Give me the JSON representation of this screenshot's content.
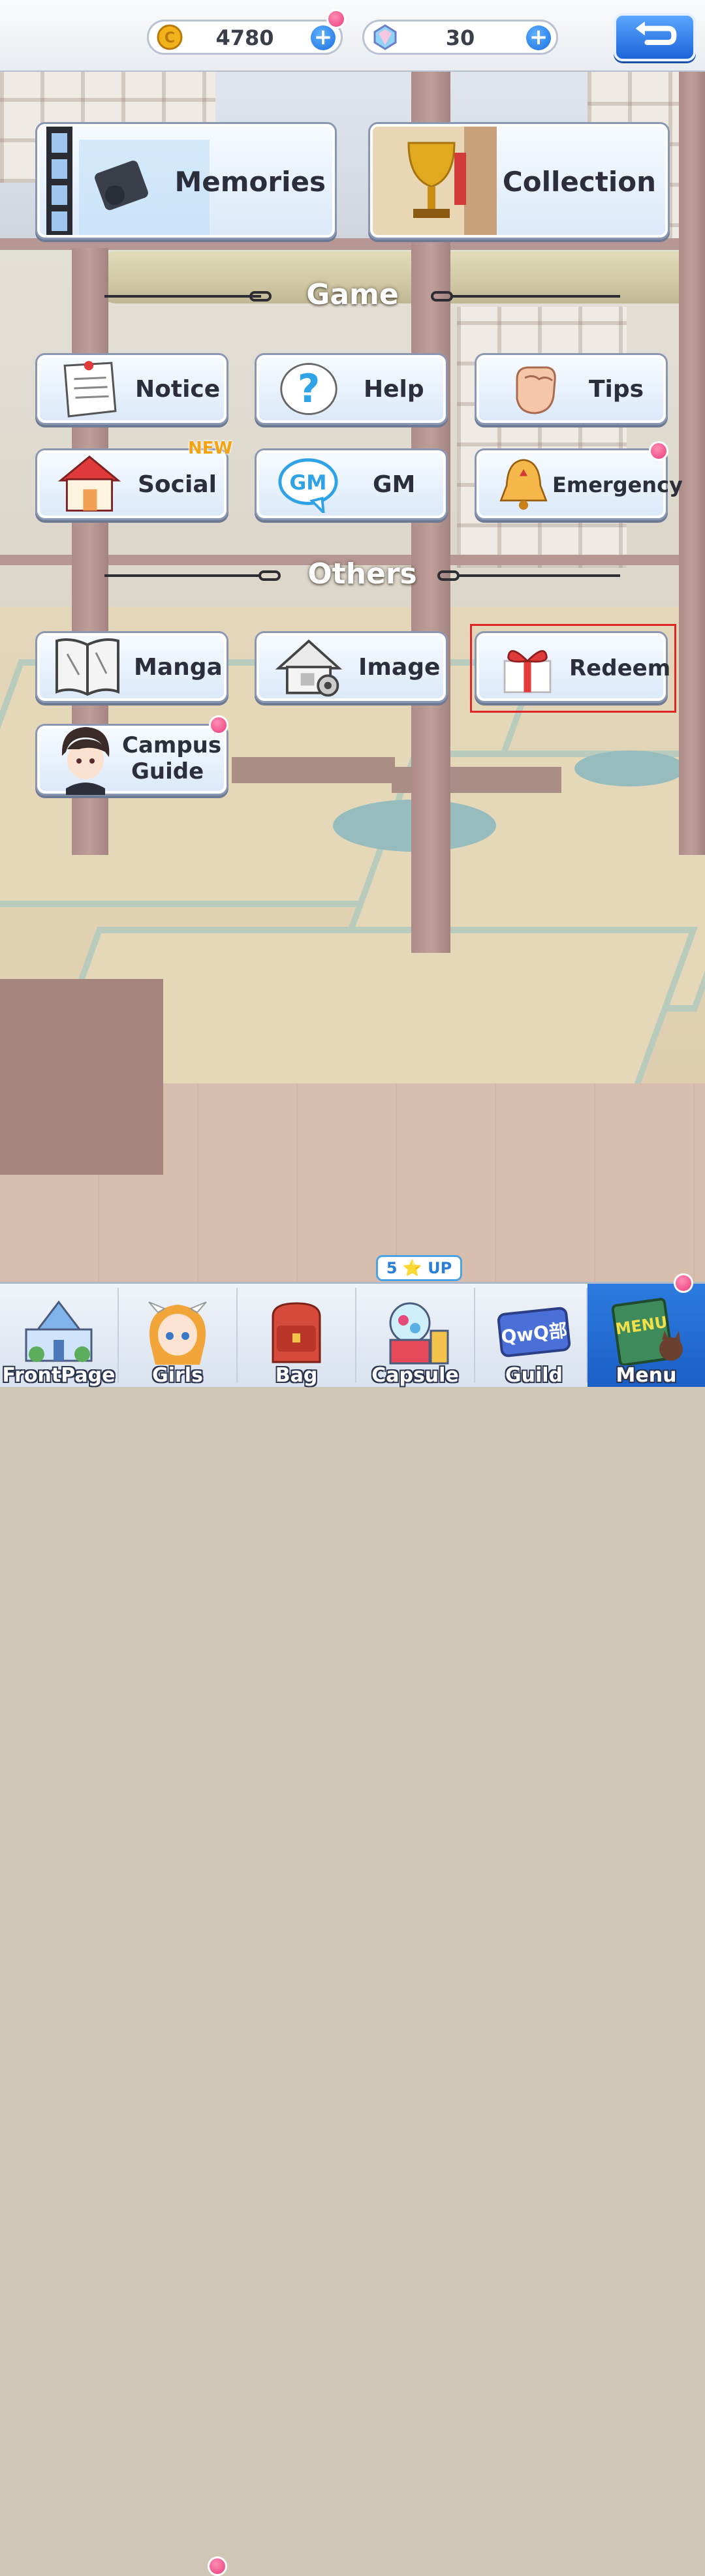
{
  "currencies": {
    "coins": {
      "value": "4780"
    },
    "gems": {
      "value": "30"
    }
  },
  "menu": {
    "top": [
      {
        "label": "Memories"
      },
      {
        "label": "Collection"
      }
    ],
    "game_section": "Game",
    "game": [
      {
        "label": "Notice"
      },
      {
        "label": "Help"
      },
      {
        "label": "Tips"
      },
      {
        "label": "Social",
        "badge": "NEW"
      },
      {
        "label": "GM",
        "icon_text": "GM"
      },
      {
        "label": "Emergency"
      }
    ],
    "others_section": "Others",
    "others": [
      {
        "label": "Manga"
      },
      {
        "label": "Image"
      },
      {
        "label": "Redeem"
      },
      {
        "label_line1": "Campus",
        "label_line2": "Guide"
      }
    ]
  },
  "nav": {
    "capsule_badge": "5 ⭐ UP",
    "items": [
      {
        "label": "FrontPage"
      },
      {
        "label": "Girls"
      },
      {
        "label": "Bag"
      },
      {
        "label": "Capsule"
      },
      {
        "label": "Guild",
        "icon_text": "QwQ部"
      },
      {
        "label": "Menu",
        "icon_text": "MENU"
      }
    ]
  },
  "colors": {
    "accent": "#1d64d8",
    "notification": "#ea3b7a",
    "highlight": "#e0262b"
  }
}
